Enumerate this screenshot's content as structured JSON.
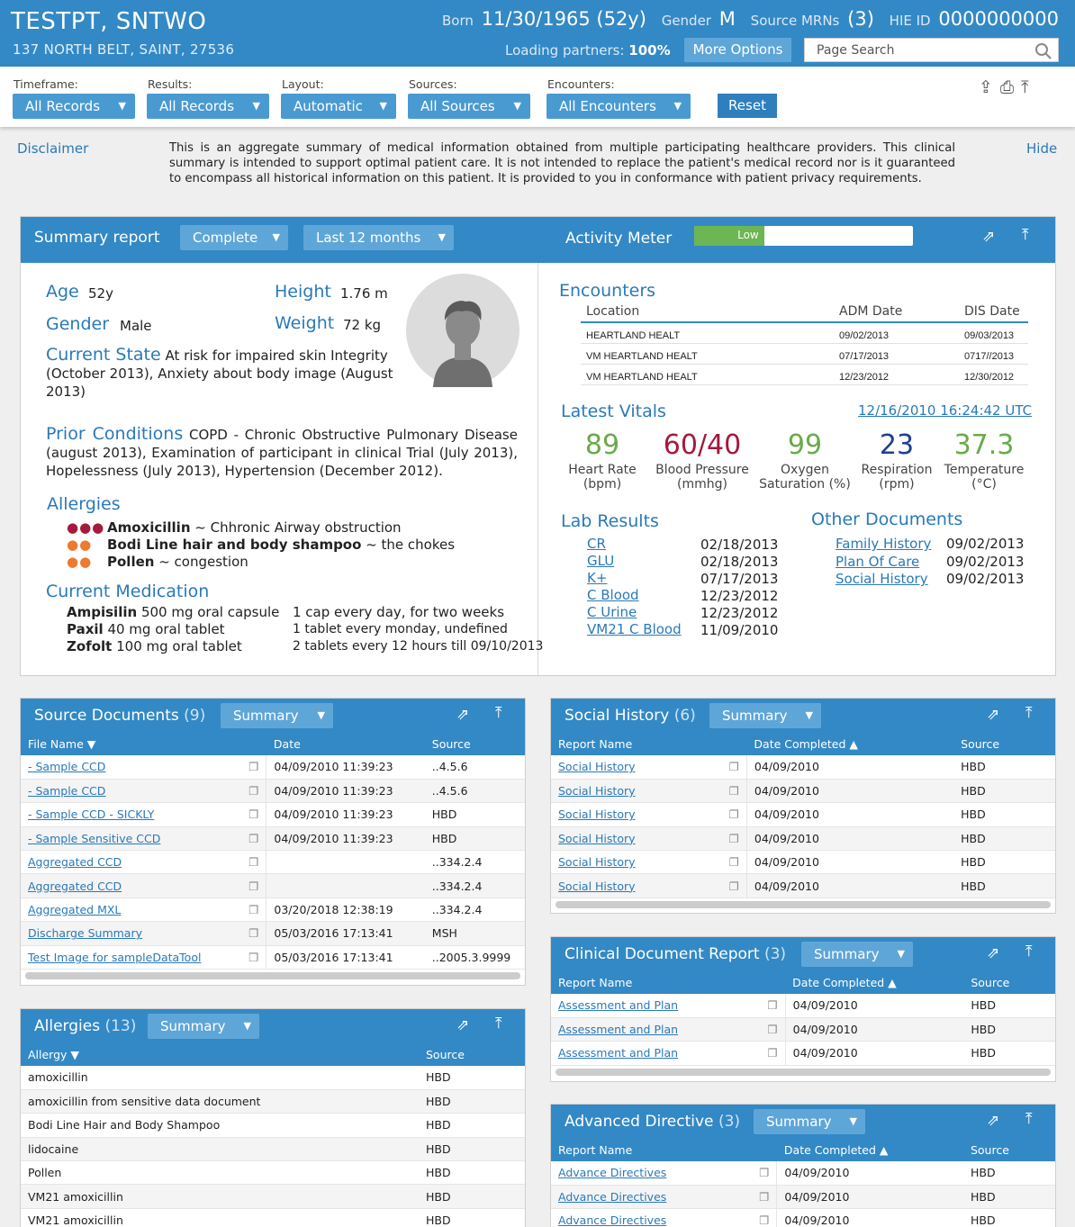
{
  "header": {
    "patient_name": "TESTPT, SNTWO",
    "address": "137 NORTH BELT, SAINT, 27536",
    "born_label": "Born",
    "born_value": "11/30/1965 (52y)",
    "gender_label": "Gender",
    "gender_value": "M",
    "mrn_label": "Source MRNs",
    "mrn_value": "(3)",
    "hie_label": "HIE ID",
    "hie_value": "0000000000",
    "loading_label": "Loading partners:",
    "loading_value": "100%",
    "more_options": "More Options",
    "search_placeholder": "Page Search"
  },
  "filters": {
    "timeframe_label": "Timeframe:",
    "timeframe_value": "All Records",
    "results_label": "Results:",
    "results_value": "All Records",
    "layout_label": "Layout:",
    "layout_value": "Automatic",
    "sources_label": "Sources:",
    "sources_value": "All Sources",
    "encounters_label": "Encounters:",
    "encounters_value": "All Encounters",
    "reset": "Reset"
  },
  "disclaimer": {
    "label": "Disclaimer",
    "text": "This is an aggregate summary of medical information obtained from multiple participating healthcare providers. This clinical summary is intended to support optimal patient care. It is not intended to replace the patient's medical record nor is it guaranteed to encompass all historical information on this patient. It is provided to you in conformance with patient privacy requirements.",
    "hide": "Hide"
  },
  "summary": {
    "title": "Summary report",
    "type_value": "Complete",
    "range_value": "Last 12 months",
    "activity_label": "Activity Meter",
    "activity_level": "Low",
    "activity_fraction": 0.2,
    "age_label": "Age",
    "age_value": "52y",
    "height_label": "Height",
    "height_value": "1.76 m",
    "gender_label": "Gender",
    "gender_value": "Male",
    "weight_label": "Weight",
    "weight_value": "72 kg",
    "current_state_label": "Current State",
    "current_state_value": "At risk for impaired skin Integrity (October 2013), Anxiety about body image (August 2013)",
    "prior_label": "Prior Conditions",
    "prior_value": "COPD - Chronic Obstructive Pulmonary Disease (august 2013), Examination of participant in clinical Trial (July 2013), Hopelessness (July 2013), Hypertension (December 2012).",
    "allergies_label": "Allergies",
    "allergies": [
      {
        "name": "Amoxicillin",
        "reaction": "~ Chhronic Airway obstruction",
        "severity": 3,
        "color": "#a4193d"
      },
      {
        "name": "Bodi Line hair and body shampoo",
        "reaction": "~ the chokes",
        "severity": 2,
        "color": "#ec7a2f"
      },
      {
        "name": "Pollen",
        "reaction": "~ congestion",
        "severity": 2,
        "color": "#ec7a2f"
      }
    ],
    "medication_label": "Current Medication",
    "medications": [
      {
        "name": "Ampisilin",
        "detail": "500 mg oral capsule",
        "instructions": "1 cap every day, for two weeks"
      },
      {
        "name": "Paxil",
        "detail": "40 mg oral tablet",
        "instructions": "1 tablet every monday, undefined"
      },
      {
        "name": "Zofolt",
        "detail": "100 mg oral tablet",
        "instructions": "2 tablets every 12 hours till 09/10/2013"
      }
    ],
    "encounters_label": "Encounters",
    "enc_headers": [
      "Location",
      "ADM Date",
      "DIS Date"
    ],
    "encounters": [
      [
        "HEARTLAND HEALT",
        "09/02/2013",
        "09/03/2013"
      ],
      [
        "VM HEARTLAND HEALT",
        "07/17/2013",
        "0717//2013"
      ],
      [
        "VM HEARTLAND HEALT",
        "12/23/2012",
        "12/30/2012"
      ]
    ],
    "vitals_label": "Latest Vitals",
    "vitals_time": "12/16/2010 16:24:42 UTC",
    "vitals": [
      {
        "value": "89",
        "label": "Heart Rate",
        "unit": "(bpm)",
        "color": "#6aaa4a"
      },
      {
        "value": "60/40",
        "label": "Blood Pressure",
        "unit": "(mmhg)",
        "color": "#a4193d"
      },
      {
        "value": "99",
        "label": "Oxygen",
        "unit": "Saturation (%)",
        "color": "#6aaa4a"
      },
      {
        "value": "23",
        "label": "Respiration",
        "unit": "(rpm)",
        "color": "#1d3f8f"
      },
      {
        "value": "37.3",
        "label": "Temperature",
        "unit": "(°C)",
        "color": "#6aaa4a"
      }
    ],
    "labs_label": "Lab Results",
    "labs": [
      [
        "CR",
        "02/18/2013"
      ],
      [
        "GLU",
        "02/18/2013"
      ],
      [
        "K+",
        "07/17/2013"
      ],
      [
        "C Blood",
        "12/23/2012"
      ],
      [
        "C Urine",
        "12/23/2012"
      ],
      [
        "VM21 C Blood",
        "11/09/2010"
      ]
    ],
    "docs_label": "Other Documents",
    "docs": [
      [
        "Family History",
        "09/02/2013"
      ],
      [
        "Plan Of Care",
        "09/02/2013"
      ],
      [
        "Social History",
        "09/02/2013"
      ]
    ]
  },
  "source_docs": {
    "title": "Source Documents",
    "count": "(9)",
    "view": "Summary",
    "headers": [
      "File Name ▼",
      "Date",
      "Source"
    ],
    "rows": [
      [
        "- Sample CCD",
        "04/09/2010 11:39:23",
        "..4.5.6"
      ],
      [
        "- Sample CCD",
        "04/09/2010 11:39:23",
        "..4.5.6"
      ],
      [
        "- Sample CCD - SICKLY",
        "04/09/2010 11:39:23",
        "HBD"
      ],
      [
        "- Sample Sensitive CCD",
        "04/09/2010 11:39:23",
        "HBD"
      ],
      [
        "Aggregated CCD",
        "",
        "..334.2.4"
      ],
      [
        "Aggregated CCD",
        "",
        "..334.2.4"
      ],
      [
        "Aggregated MXL",
        "03/20/2018 12:38:19",
        "..334.2.4"
      ],
      [
        "Discharge Summary",
        "05/03/2016 17:13:41",
        "MSH"
      ],
      [
        "Test Image for sampleDataTool",
        "05/03/2016 17:13:41",
        "..2005.3.9999"
      ]
    ]
  },
  "social": {
    "title": "Social History",
    "count": "(6)",
    "view": "Summary",
    "headers": [
      "Report Name",
      "Date Completed ▲",
      "Source"
    ],
    "rows": [
      [
        "Social History",
        "04/09/2010",
        "HBD"
      ],
      [
        "Social History",
        "04/09/2010",
        "HBD"
      ],
      [
        "Social History",
        "04/09/2010",
        "HBD"
      ],
      [
        "Social History",
        "04/09/2010",
        "HBD"
      ],
      [
        "Social History",
        "04/09/2010",
        "HBD"
      ],
      [
        "Social History",
        "04/09/2010",
        "HBD"
      ]
    ]
  },
  "clinical": {
    "title": "Clinical Document Report",
    "count": "(3)",
    "view": "Summary",
    "headers": [
      "Report Name",
      "Date Completed ▲",
      "Source"
    ],
    "rows": [
      [
        "Assessment and Plan",
        "04/09/2010",
        "HBD"
      ],
      [
        "Assessment and Plan",
        "04/09/2010",
        "HBD"
      ],
      [
        "Assessment and Plan",
        "04/09/2010",
        "HBD"
      ]
    ]
  },
  "allergy_panel": {
    "title": "Allergies",
    "count": "(13)",
    "view": "Summary",
    "headers": [
      "Allergy ▼",
      "Source"
    ],
    "rows": [
      [
        "amoxicillin",
        "HBD"
      ],
      [
        "amoxicillin from sensitive data document",
        "HBD"
      ],
      [
        "Bodi Line Hair and Body Shampoo",
        "HBD"
      ],
      [
        "lidocaine",
        "HBD"
      ],
      [
        "Pollen",
        "HBD"
      ],
      [
        "VM21 amoxicillin",
        "HBD"
      ],
      [
        "VM21 amoxicillin",
        "HBD"
      ]
    ]
  },
  "directive": {
    "title": "Advanced Directive",
    "count": "(3)",
    "view": "Summary",
    "headers": [
      "Report Name",
      "Date Completed ▲",
      "Source"
    ],
    "rows": [
      [
        "Advance Directives",
        "04/09/2010",
        "HBD"
      ],
      [
        "Advance Directives",
        "04/09/2010",
        "HBD"
      ],
      [
        "Advance Directives",
        "04/09/2010",
        "HBD"
      ]
    ]
  }
}
